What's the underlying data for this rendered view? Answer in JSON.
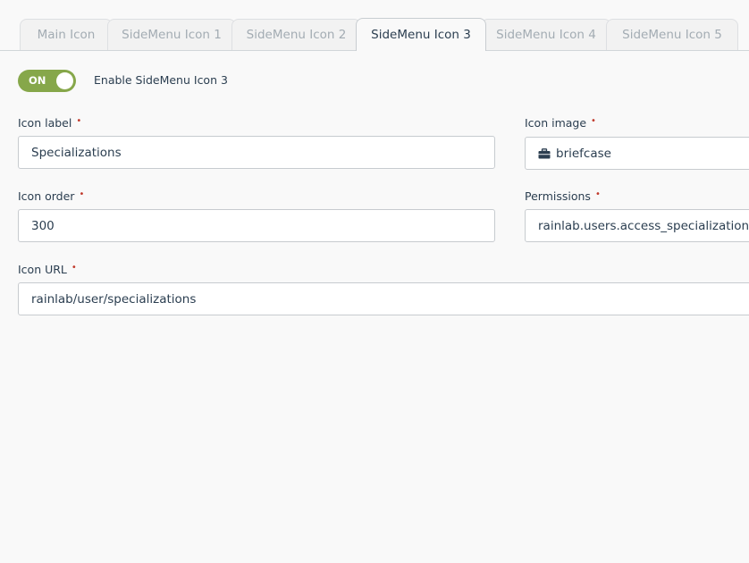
{
  "tabs": [
    {
      "label": "Main Icon",
      "active": false
    },
    {
      "label": "SideMenu Icon 1",
      "active": false
    },
    {
      "label": "SideMenu Icon 2",
      "active": false
    },
    {
      "label": "SideMenu Icon 3",
      "active": true
    },
    {
      "label": "SideMenu Icon 4",
      "active": false
    },
    {
      "label": "SideMenu Icon 5",
      "active": false
    }
  ],
  "toggle": {
    "state": "ON",
    "label": "Enable SideMenu Icon 3",
    "color": "#86a74a"
  },
  "form": {
    "icon_label": {
      "label": "Icon label",
      "value": "Specializations"
    },
    "icon_image": {
      "label": "Icon image",
      "value": "briefcase",
      "icon": "briefcase-icon"
    },
    "icon_order": {
      "label": "Icon order",
      "value": "300"
    },
    "permissions": {
      "label": "Permissions",
      "value": "rainlab.users.access_specializations"
    },
    "icon_url": {
      "label": "Icon URL",
      "value": "rainlab/user/specializations"
    }
  },
  "required_marker": "•"
}
